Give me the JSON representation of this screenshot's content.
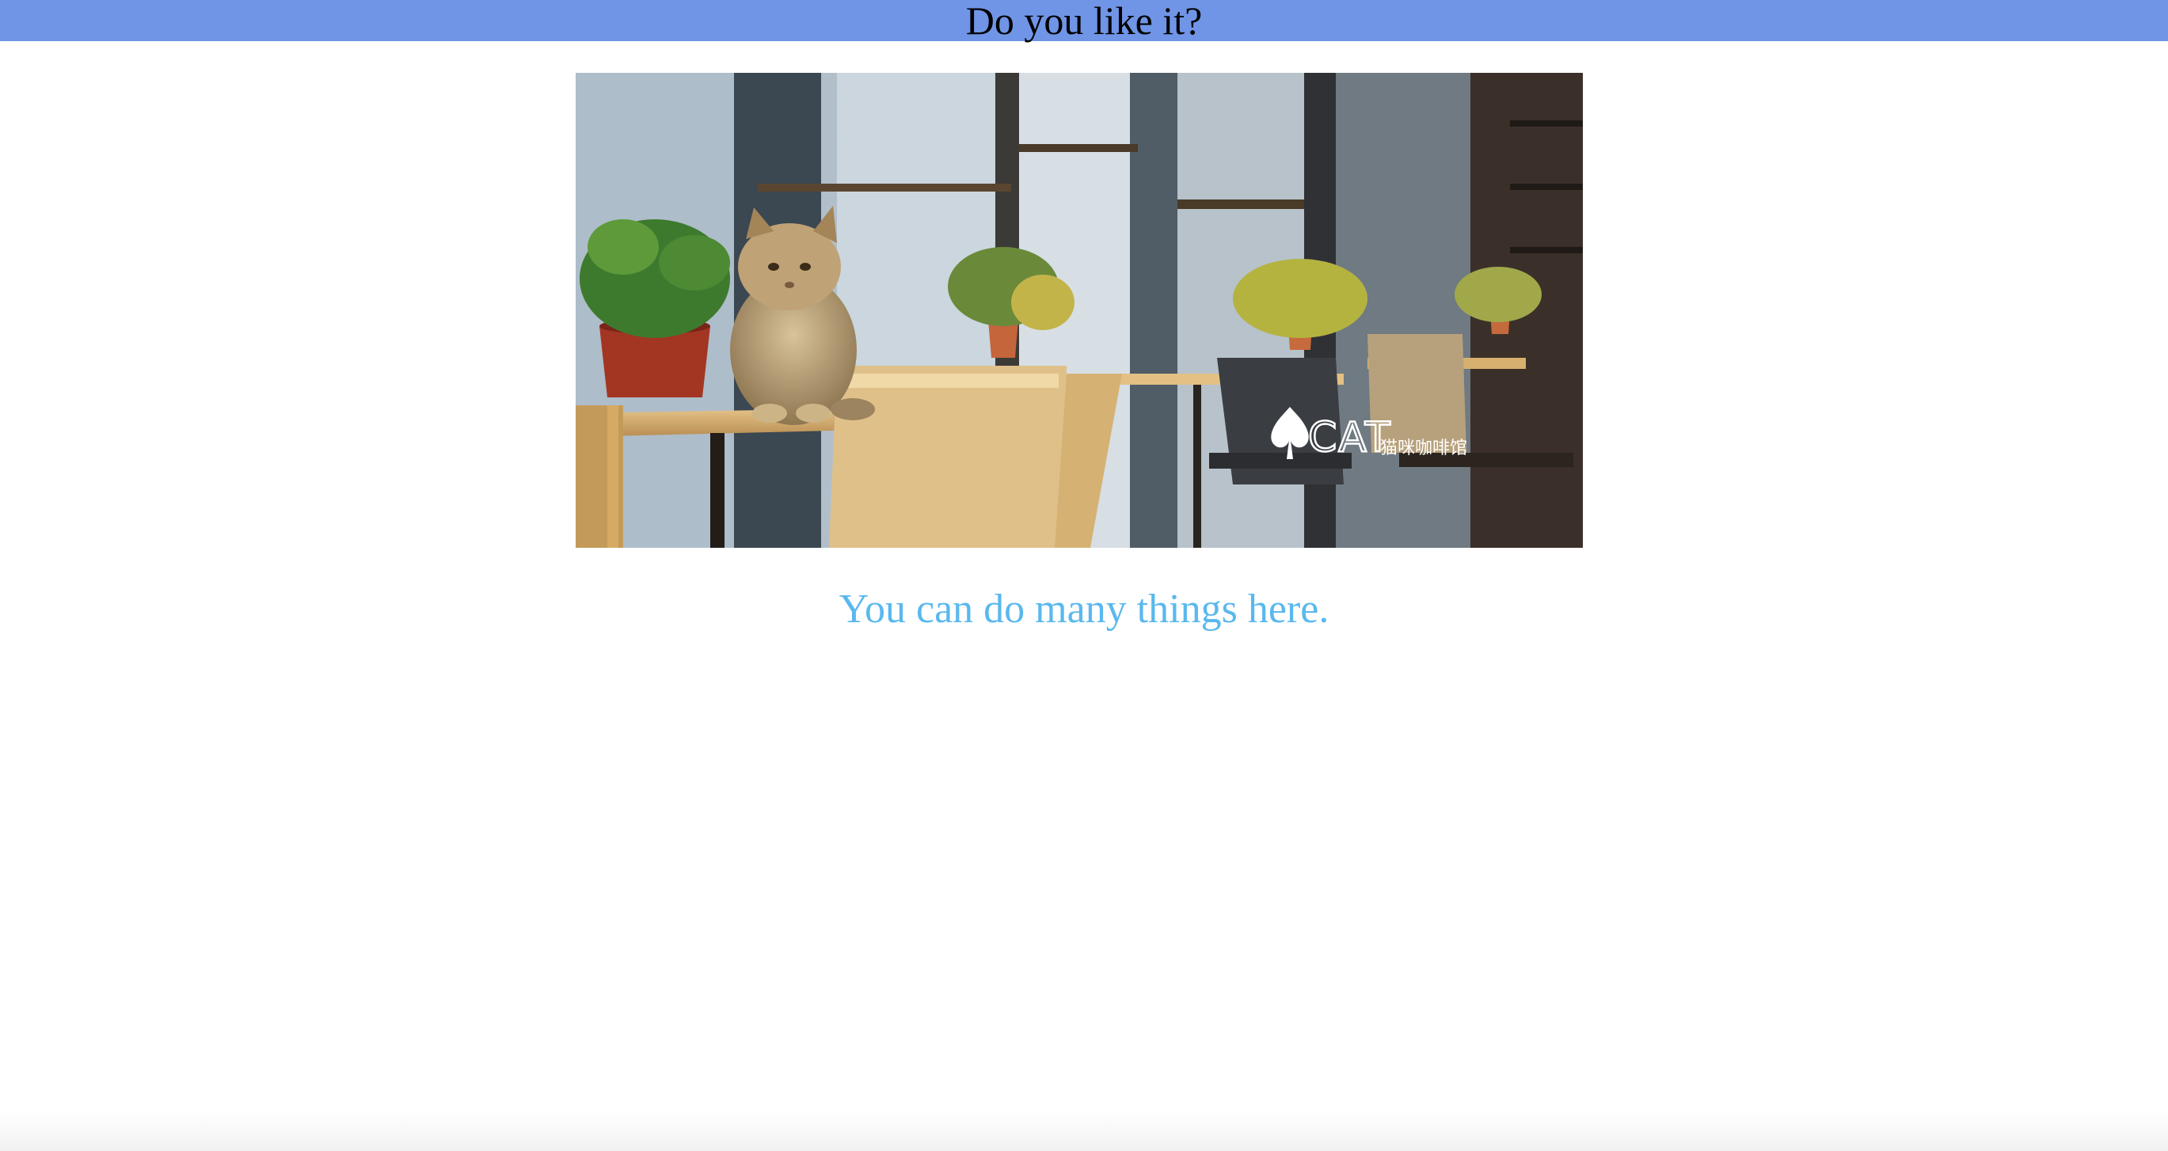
{
  "header": {
    "title": "Do you like it?",
    "background_color": "#7095e7"
  },
  "hero_image": {
    "logo_text": "CAT",
    "logo_subtext": "猫咪咖啡馆"
  },
  "caption": {
    "text": "You can do many things here.",
    "color": "#5ab8ee"
  }
}
